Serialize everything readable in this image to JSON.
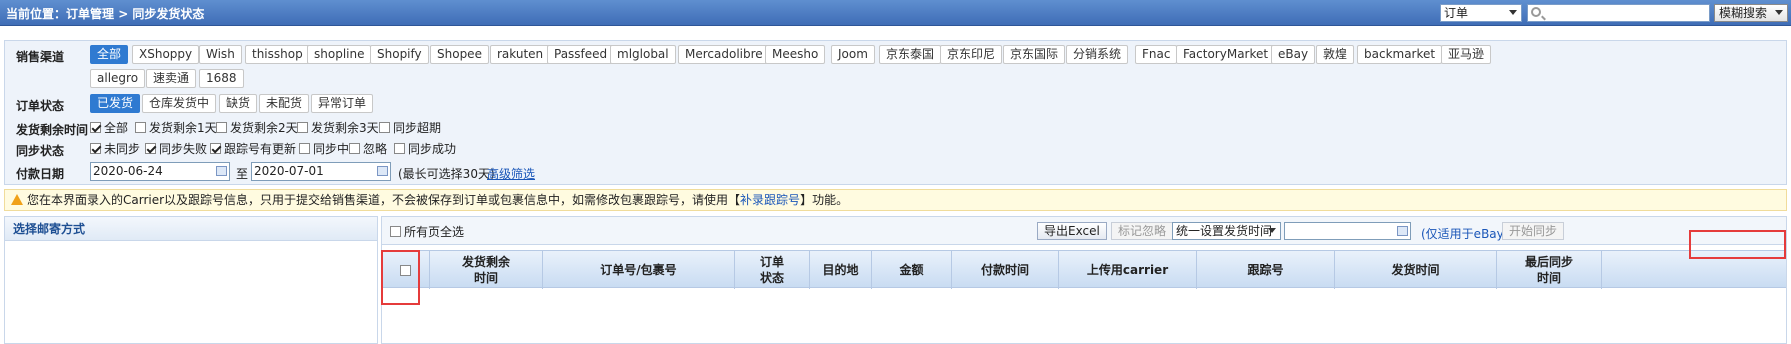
{
  "topbar": {
    "breadcrumb_prefix": "当前位置：",
    "breadcrumb_path": "订单管理 > 同步发货状态",
    "search_type": "订单",
    "search_value": "",
    "fuzzy_label": "模糊搜索"
  },
  "filters": {
    "channel_label": "销售渠道",
    "channels": [
      "全部",
      "XShoppy",
      "Wish",
      "thisshop",
      "shopline",
      "Shopify",
      "Shopee",
      "rakuten",
      "Passfeed",
      "mlglobal",
      "Mercadolibre",
      "Meesho",
      "Joom",
      "京东泰国",
      "京东印尼",
      "京东国际",
      "分销系统",
      "Fnac",
      "FactoryMarket",
      "eBay",
      "敦煌",
      "backmarket",
      "亚马逊",
      "allegro",
      "速卖通",
      "1688"
    ],
    "status_label": "订单状态",
    "statuses": [
      "已发货",
      "仓库发货中",
      "缺货",
      "未配货",
      "异常订单"
    ],
    "remaining_label": "发货剩余时间",
    "remaining_options": [
      {
        "label": "全部",
        "checked": true
      },
      {
        "label": "发货剩余1天",
        "checked": false
      },
      {
        "label": "发货剩余2天",
        "checked": false
      },
      {
        "label": "发货剩余3天",
        "checked": false
      },
      {
        "label": "同步超期",
        "checked": false
      }
    ],
    "sync_label": "同步状态",
    "sync_options": [
      {
        "label": "未同步",
        "checked": true
      },
      {
        "label": "同步失败",
        "checked": true
      },
      {
        "label": "跟踪号有更新",
        "checked": true
      },
      {
        "label": "同步中",
        "checked": false
      },
      {
        "label": "忽略",
        "checked": false
      },
      {
        "label": "同步成功",
        "checked": false
      }
    ],
    "pay_date_label": "付款日期",
    "date_from": "2020-06-24",
    "date_to_label": "至",
    "date_to": "2020-07-01",
    "date_hint": "(最长可选择30天)",
    "advanced_filter": "高级筛选"
  },
  "warning": {
    "text_before": "您在本界面录入的Carrier以及跟踪号信息，只用于提交给销售渠道，不会被保存到订单或包裹信息中，如需修改包裹跟踪号，请使用【",
    "link": "补录跟踪号",
    "text_after": "】功能。"
  },
  "left_panel": {
    "title": "选择邮寄方式"
  },
  "toolbar": {
    "select_all_pages": "所有页全选",
    "export_excel": "导出Excel",
    "mark_ignore": "标记忽略",
    "ship_time_select": "统一设置发货时间",
    "ship_time_value": "",
    "ebay_note": "(仅适用于eBay)",
    "start_sync": "开始同步"
  },
  "table": {
    "headers": [
      "",
      "发货剩余\n时间",
      "订单号/包裹号",
      "订单\n状态",
      "目的地",
      "金额",
      "付款时间",
      "上传用carrier",
      "跟踪号",
      "发货时间",
      "最后同步\n时间"
    ]
  },
  "colors": {
    "accent": "#2f7ad1",
    "highlight_box": "#e53b3b",
    "topbar": "#3f6db6"
  }
}
